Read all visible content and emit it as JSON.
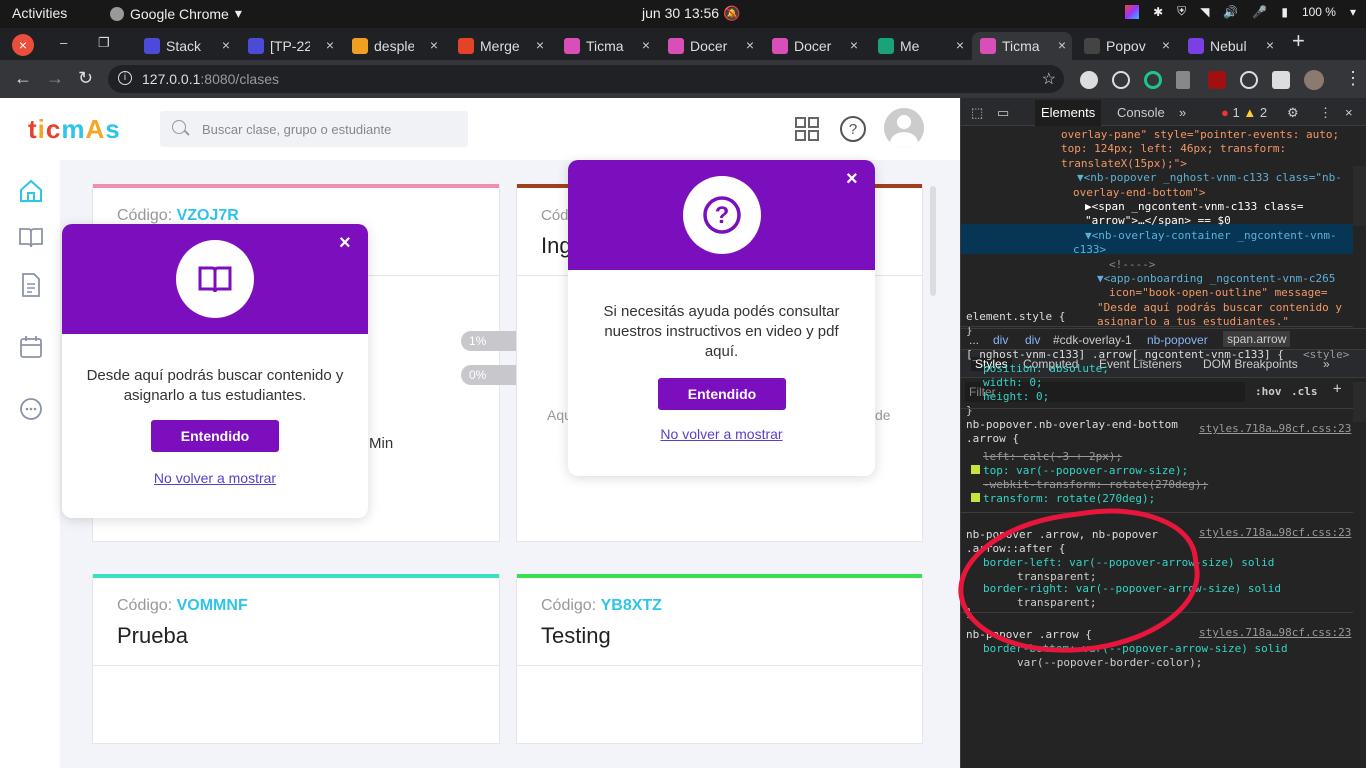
{
  "os": {
    "activities": "Activities",
    "app_name": "Google Chrome",
    "clock": "jun 30  13:56",
    "battery": "100 %"
  },
  "tabs": [
    {
      "label": "Stack",
      "color": "#4b4bd8"
    },
    {
      "label": "[TP-22",
      "color": "#4b4bd8"
    },
    {
      "label": "desple",
      "color": "#f0a020"
    },
    {
      "label": "Merge",
      "color": "#e24329"
    },
    {
      "label": "Ticma",
      "color": "#d94fb7"
    },
    {
      "label": "Docer",
      "color": "#d94fb7"
    },
    {
      "label": "Docer",
      "color": "#d94fb7"
    },
    {
      "label": "Me",
      "color": "#1aa37a"
    },
    {
      "label": "Ticma",
      "color": "#d94fb7"
    },
    {
      "label": "Popov",
      "color": "#444"
    },
    {
      "label": "Nebul",
      "color": "#7b3fe4"
    }
  ],
  "address": {
    "host": "127.0.0.1",
    "rest": ":8080/clases"
  },
  "app": {
    "search_placeholder": "Buscar clase, grupo o estudiante",
    "logo": "ticmas",
    "cards": [
      {
        "code_label": "Código:",
        "code": "VZOJ7R",
        "name": "",
        "accent": "#f28fb0"
      },
      {
        "code_label": "Cód",
        "code": "",
        "name": "Ing",
        "accent": "#a0401a"
      },
      {
        "code_label": "Código:",
        "code": "VOMMNF",
        "name": "Prueba",
        "accent": "#36e0c0"
      },
      {
        "code_label": "Código:",
        "code": "YB8XTZ",
        "name": "Testing",
        "accent": "#36e050"
      }
    ],
    "progress": [
      "1%",
      "0%"
    ],
    "min_text": "Min",
    "faded_left": "Aqu",
    "faded_right": "de"
  },
  "popover_book": {
    "message": "Desde aquí podrás buscar contenido y asignarlo a tus estudiantes.",
    "button": "Entendido",
    "link": "No volver a mostrar",
    "close": "×"
  },
  "popover_help": {
    "message": "Si necesitás ayuda podés consultar nuestros instructivos en video y pdf aquí.",
    "button": "Entendido",
    "link": "No volver a mostrar",
    "close": "×"
  },
  "devtools": {
    "tabs": [
      "Elements",
      "Console"
    ],
    "errors": "1",
    "warnings": "2",
    "dom_lines": [
      "overlay-pane\" style=\"pointer-events: auto;",
      "top: 124px; left: 46px; transform:",
      "translateX(15px);\">",
      "▼<nb-popover _nghost-vnm-c133 class=\"nb-",
      "overlay-end-bottom\">",
      "▶<span _ngcontent-vnm-c133 class=",
      "\"arrow\">…</span> == $0",
      "▼<nb-overlay-container _ngcontent-vnm-",
      "c133>",
      "<!---->",
      "▼<app-onboarding _ngcontent-vnm-c265",
      "icon=\"book-open-outline\" message=",
      "\"Desde aquí podrás buscar contenido y",
      "asignarlo a tus estudiantes.\""
    ],
    "crumbs": [
      "...",
      "div",
      "div",
      "#cdk-overlay-1",
      "nb-popover",
      "span.arrow"
    ],
    "style_tabs": [
      "Styles",
      "Computed",
      "Event Listeners",
      "DOM Breakpoints"
    ],
    "filter_placeholder": "Filter",
    "hov": ":hov",
    "cls": ".cls",
    "rules": [
      "element.style {",
      "}",
      "[_nghost-vnm-c133] .arrow[_ngcontent-vnm-c133] {",
      "position: absolute;",
      "width: 0;",
      "height: 0;",
      "}",
      "nb-popover.nb-overlay-end-bottom",
      ".arrow {",
      "left: calc(-3 + 2px);",
      "top: var(--popover-arrow-size);",
      "-webkit-transform: rotate(270deg);",
      "transform: rotate(270deg);",
      "nb-popover .arrow, nb-popover",
      ".arrow::after {",
      "border-left: var(--popover-arrow-size) solid",
      "transparent;",
      "border-right: var(--popover-arrow-size) solid",
      "transparent;",
      "}",
      "nb-popover .arrow {",
      "border-bottom: var(--popover-arrow-size) solid",
      "var(--popover-border-color);"
    ],
    "style_tag": "<style>",
    "source": "styles.718a…98cf.css:23"
  }
}
